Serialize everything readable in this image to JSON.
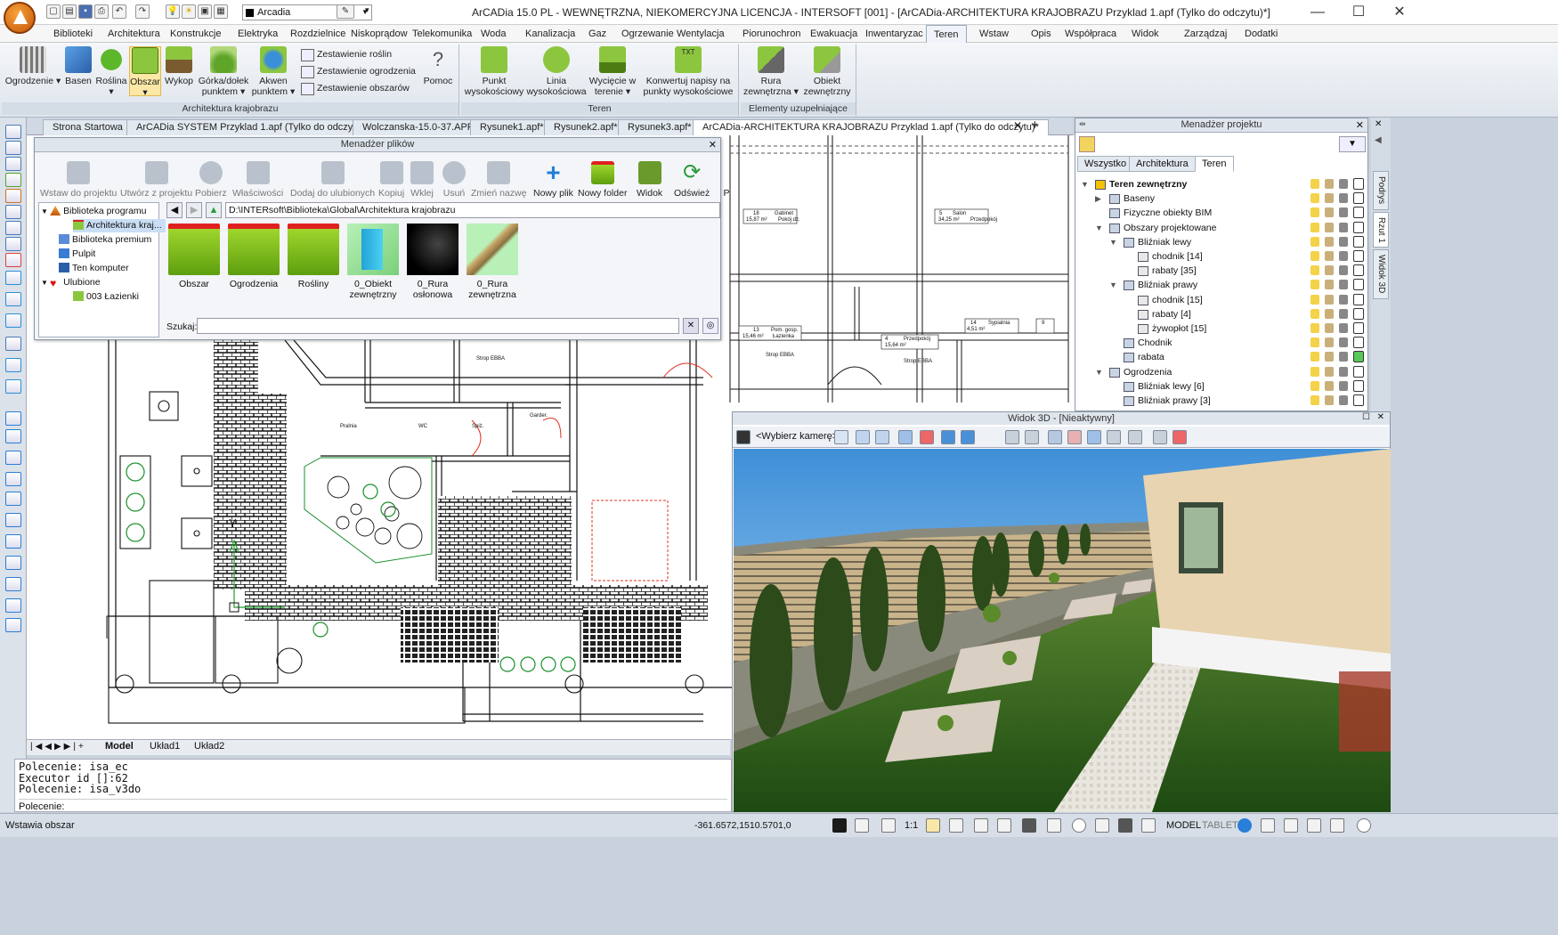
{
  "titlebar": {
    "title": "ArCADia 15.0 PL - WEWNĘTRZNA, NIEKOMERCYJNA LICENCJA - INTERSOFT [001] - [ArCADia-ARCHITEKTURA KRAJOBRAZU Przyklad 1.apf (Tylko do odczytu)*]",
    "layer_combo": "Arcadia",
    "minimize": "—",
    "maximize": "☐",
    "close": "✕"
  },
  "menu": [
    "Biblioteki",
    "Architektura",
    "Konstrukcje",
    "Elektryka",
    "Rozdzielnice",
    "Niskoprądow",
    "Telekomunika",
    "Woda",
    "Kanalizacja",
    "Gaz",
    "Ogrzewanie",
    "Wentylacja",
    "Piorunochron",
    "Ewakuacja",
    "Inwentaryzac",
    "Teren",
    "Wstaw",
    "Opis",
    "Współpraca",
    "Widok",
    "Zarządzaj",
    "Dodatki"
  ],
  "ribbon": {
    "group1": {
      "label": "Architektura krajobrazu",
      "buttons": [
        "Ogrodzenie ▾",
        "Basen",
        "Roślina ▾",
        "Obszar ▾",
        "Wykop",
        "Górka/dołek punktem ▾",
        "Akwen punktem ▾"
      ],
      "small": [
        "Zestawienie roślin",
        "Zestawienie ogrodzenia",
        "Zestawienie obszarów"
      ],
      "help": "Pomoc"
    },
    "group2": {
      "label": "Teren",
      "buttons": [
        "Punkt wysokościowy",
        "Linia wysokościowa",
        "Wycięcie w terenie ▾",
        "Konwertuj napisy na punkty wysokościowe"
      ]
    },
    "group3": {
      "label": "Elementy uzupełniające",
      "buttons": [
        "Rura zewnętrzna ▾",
        "Obiekt zewnętrzny"
      ]
    }
  },
  "doc_tabs": [
    "Strona Startowa",
    "ArCADia SYSTEM Przyklad 1.apf (Tylko do odczytu)*",
    "Wolczanska-15.0-37.APF*",
    "Rysunek1.apf*",
    "Rysunek2.apf*",
    "Rysunek3.apf*",
    "ArCADia-ARCHITEKTURA KRAJOBRAZU Przyklad 1.apf (Tylko do odczytu)*"
  ],
  "file_manager": {
    "title": "Menadżer plików",
    "toolbar": [
      "Wstaw do projektu",
      "Utwórz z projektu",
      "Pobierz",
      "Właściwości",
      "Dodaj do ulubionych",
      "Kopiuj",
      "Wklej",
      "Usuń",
      "Zmień nazwę",
      "Nowy plik",
      "Nowy folder",
      "Widok",
      "Odśwież",
      "P"
    ],
    "tree": [
      "Biblioteka programu",
      "Architektura kraj...",
      "Biblioteka premium",
      "Pulpit",
      "Ten komputer",
      "Ulubione",
      "003 Łazienki"
    ],
    "path": "D:\\INTERsoft\\Biblioteka\\Global\\Architektura krajobrazu",
    "items": [
      "Obszar",
      "Ogrodzenia",
      "Rośliny",
      "0_Obiekt zewnętrzny",
      "0_Rura osłonowa",
      "0_Rura zewnętrzna"
    ],
    "search_label": "Szukaj:",
    "search_value": ""
  },
  "drawing": {
    "axis_y": "Y",
    "rooms": [
      "Gabinet",
      "Salon",
      "Pom. gosp.",
      "Łazienka",
      "Sypialnia",
      "Pokój dz.",
      "Przedpokój",
      "Pralnia",
      "WC",
      "Spiż.",
      "Garder."
    ],
    "room_codes": [
      "18",
      "5",
      "13",
      "14",
      "4",
      "9"
    ],
    "areas": [
      "15,87 m²",
      "34,25 m²",
      "15,46 m²",
      "4,51 m²",
      "15,64 m²"
    ],
    "floors": [
      "Strop EBBA",
      "Strop EBBA",
      "Strop EBBA"
    ]
  },
  "layout_tabs": [
    "Model",
    "Układ1",
    "Układ2"
  ],
  "command": [
    "Polecenie: isa_ec",
    "Executor id []:62",
    "Polecenie: isa_v3do",
    "Polecenie:"
  ],
  "project_manager": {
    "title": "Menadżer projektu",
    "tabs": [
      "Wszystko",
      "Architektura",
      "Teren"
    ],
    "rows": [
      {
        "label": "Teren zewnętrzny",
        "level": 0,
        "exp": "▼",
        "bold": true
      },
      {
        "label": "Baseny",
        "level": 1,
        "exp": "▶"
      },
      {
        "label": "Fizyczne obiekty BIM",
        "level": 1,
        "exp": ""
      },
      {
        "label": "Obszary projektowane",
        "level": 1,
        "exp": "▼"
      },
      {
        "label": "Bliźniak lewy",
        "level": 2,
        "exp": "▼"
      },
      {
        "label": "chodnik [14]",
        "level": 3,
        "exp": ""
      },
      {
        "label": "rabaty [35]",
        "level": 3,
        "exp": ""
      },
      {
        "label": "Bliźniak prawy",
        "level": 2,
        "exp": "▼"
      },
      {
        "label": "chodnik [15]",
        "level": 3,
        "exp": ""
      },
      {
        "label": "rabaty [4]",
        "level": 3,
        "exp": ""
      },
      {
        "label": "żywopłot [15]",
        "level": 3,
        "exp": ""
      },
      {
        "label": "Chodnik",
        "level": 2,
        "exp": ""
      },
      {
        "label": "rabata",
        "level": 2,
        "exp": ""
      },
      {
        "label": "Ogrodzenia",
        "level": 1,
        "exp": "▼"
      },
      {
        "label": "Bliźniak lewy [6]",
        "level": 2,
        "exp": ""
      },
      {
        "label": "Bliźniak prawy [3]",
        "level": 2,
        "exp": ""
      }
    ]
  },
  "right_vtabs": [
    "Podrys",
    "Rzut 1",
    "Widok 3D"
  ],
  "view3d": {
    "title": "Widok 3D - [Nieaktywny]",
    "camera": "<Wybierz kamerę>"
  },
  "status": {
    "left": "Wstawia obszar",
    "coords": "-361.6572,1510.5701,0",
    "scale": "1:1",
    "model": "MODEL",
    "tablet": "TABLET"
  }
}
